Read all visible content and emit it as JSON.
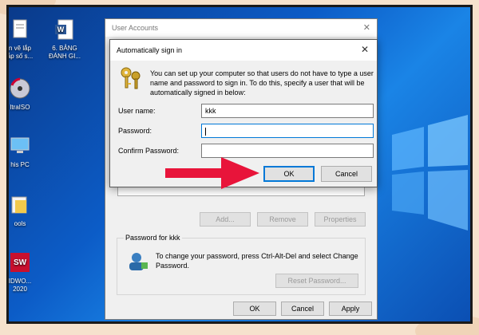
{
  "desktop": {
    "icons": [
      {
        "label": "n vẽ lắp\nẫp số s...",
        "icon": "file-icon"
      },
      {
        "label": "6. BẢNG\nĐÁNH GI...",
        "icon": "word-doc-icon"
      },
      {
        "label": "ltraISO",
        "icon": "disc-icon"
      },
      {
        "label": "his PC",
        "icon": "computer-icon"
      },
      {
        "label": "ools",
        "icon": "folder-icon"
      },
      {
        "label": "IDWO...\n2020",
        "icon": "solidworks-icon"
      }
    ],
    "solidworks_badge": "2020"
  },
  "user_accounts": {
    "title": "User Accounts",
    "buttons": {
      "add": "Add...",
      "remove": "Remove",
      "properties": "Properties"
    },
    "password_group": {
      "label": "Password for kkk",
      "text": "To change your password, press Ctrl-Alt-Del and select Change Password.",
      "reset_button": "Reset Password..."
    },
    "footer": {
      "ok": "OK",
      "cancel": "Cancel",
      "apply": "Apply"
    }
  },
  "auto_sign_in": {
    "title": "Automatically sign in",
    "description": "You can set up your computer so that users do not have to type a user name and password to sign in. To do this, specify a user that will be automatically signed in below:",
    "fields": {
      "user_name_label": "User name:",
      "user_name_value": "kkk",
      "password_label": "Password:",
      "password_value": "",
      "confirm_label": "Confirm Password:",
      "confirm_value": ""
    },
    "buttons": {
      "ok": "OK",
      "cancel": "Cancel"
    }
  },
  "colors": {
    "accent": "#0078d7",
    "arrow": "#e8143a",
    "desktop_blue": "#0c5cc7"
  }
}
